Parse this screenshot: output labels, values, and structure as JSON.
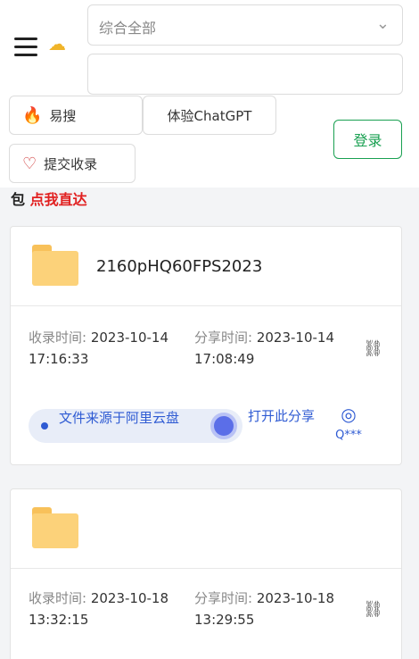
{
  "header": {
    "category_select": {
      "value": "综合全部"
    },
    "search": {
      "placeholder": ""
    },
    "hot_button": {
      "label": "易搜"
    },
    "chatgpt_button": {
      "label": "体验ChatGPT"
    },
    "submit_button": {
      "label": "提交收录"
    },
    "login_button": {
      "label": "登录"
    }
  },
  "breadcrumb": {
    "prefix": "包",
    "link": "点我直达"
  },
  "results": [
    {
      "title": "2160pHQ60FPS2023",
      "collected_label": "收录时间:",
      "collected_value": "2023-10-14 17:16:33",
      "shared_label": "分享时间:",
      "shared_value": "2023-10-14 17:08:49",
      "source_text": "文件来源于阿里云盘",
      "open_share": "打开此分享",
      "user": "Q***"
    },
    {
      "title": "",
      "collected_label": "收录时间:",
      "collected_value": "2023-10-18 13:32:15",
      "shared_label": "分享时间:",
      "shared_value": "2023-10-18 13:29:55"
    }
  ],
  "colors": {
    "brand_green": "#19a051",
    "link_blue": "#2f5bd3",
    "highlight_red": "#e12020"
  },
  "icons": {
    "menu": "hamburger-icon",
    "hot": "fire-icon",
    "favorite": "heart-icon",
    "folder": "folder-icon",
    "link": "link-broken-icon",
    "user": "user-icon"
  }
}
